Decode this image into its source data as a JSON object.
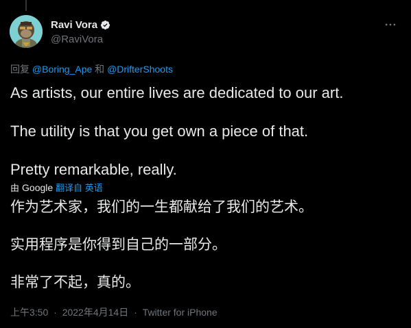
{
  "author": {
    "display_name": "Ravi Vora",
    "handle": "@RaviVora",
    "verified_icon": "verified-badge-icon",
    "avatar_icon": "bored-ape-avatar"
  },
  "more_icon": "more-options-icon",
  "reply": {
    "prefix": "回复",
    "mention1": "@Boring_Ape",
    "joiner": "和",
    "mention2": "@DrifterShoots"
  },
  "tweet": {
    "paragraphs": [
      "As artists, our entire lives are dedicated to our art.",
      "The utility is that you get own a piece of that.",
      "Pretty remarkable, really."
    ]
  },
  "translation": {
    "by_label": "由",
    "provider": "Google",
    "link_label": "翻译自 英语",
    "paragraphs": [
      "作为艺术家，我们的一生都献给了我们的艺术。",
      "实用程序是你得到自己的一部分。",
      "非常了不起，真的。"
    ]
  },
  "meta": {
    "time": "上午3:50",
    "separator": "·",
    "date": "2022年4月14日",
    "source": "Twitter for iPhone"
  },
  "colors": {
    "background": "#000000",
    "text": "#e7e9ea",
    "secondary": "#71767b",
    "accent": "#1d9bf0"
  }
}
